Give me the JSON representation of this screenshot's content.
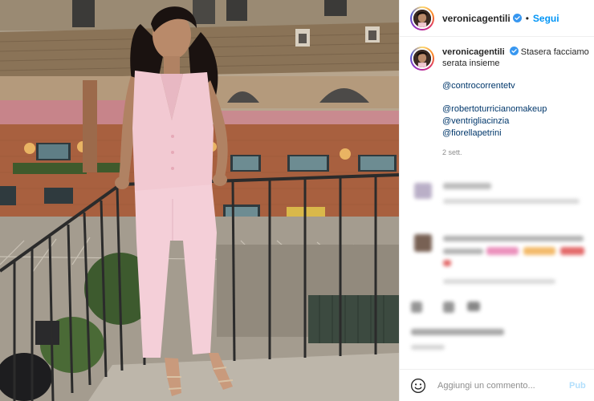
{
  "post": {
    "username": "veronicagentili",
    "dot": "•",
    "follow_label": "Segui",
    "caption": "Stasera facciamo serata insieme",
    "mentions": [
      "@controcorrentetv",
      "@robertoturricianomakeup",
      "@ventrigliacinzia",
      "@fiorellapetrini"
    ],
    "time_ago": "2 sett."
  },
  "comment_box": {
    "placeholder": "Aggiungi un commento...",
    "publish_label": "Pub"
  },
  "icons": {
    "verified": "verified-badge-icon",
    "emoji": "emoji-smiley-icon"
  },
  "colors": {
    "follow_blue": "#0095f6",
    "mention_blue": "#00376b",
    "verified_blue": "#3897f0",
    "muted_gray": "#8e8e8e",
    "publish_disabled": "#b2dffc"
  }
}
